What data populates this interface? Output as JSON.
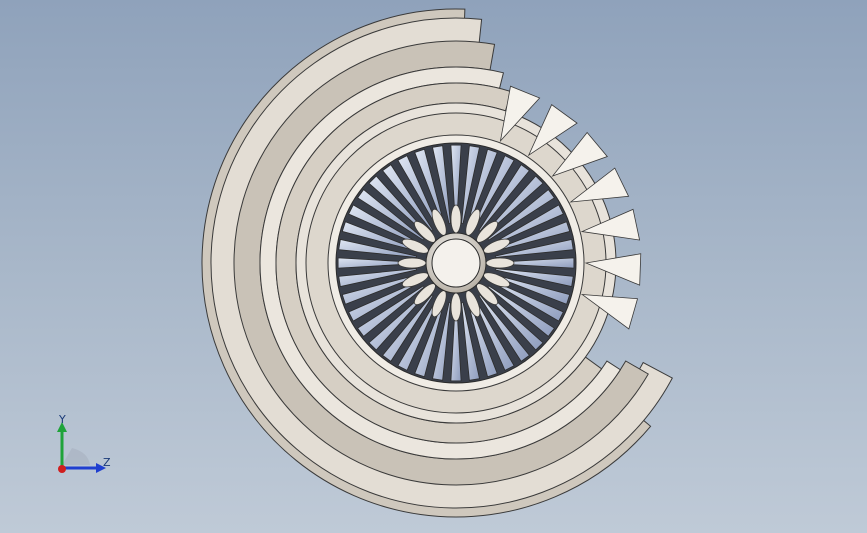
{
  "window": {
    "title": ""
  },
  "viewport": {
    "background_top": "#8fa2bb",
    "background_bottom": "#bfcad7",
    "model": {
      "part": "turbine-impeller-with-volute-casing",
      "display_mode": "shaded-with-edges",
      "casing_color": "#d8d2c8",
      "casing_shadow": "#8f887e",
      "blade_color": "#b9c4dc",
      "blade_edge": "#2c2c2c",
      "outer_blade_count": 40,
      "inner_petal_count": 16
    }
  },
  "triad": {
    "y_label": "Y",
    "z_label": "Z",
    "y_color": "#1fa33a",
    "z_color": "#1f3fd0",
    "x_color": "#d01f1f"
  }
}
